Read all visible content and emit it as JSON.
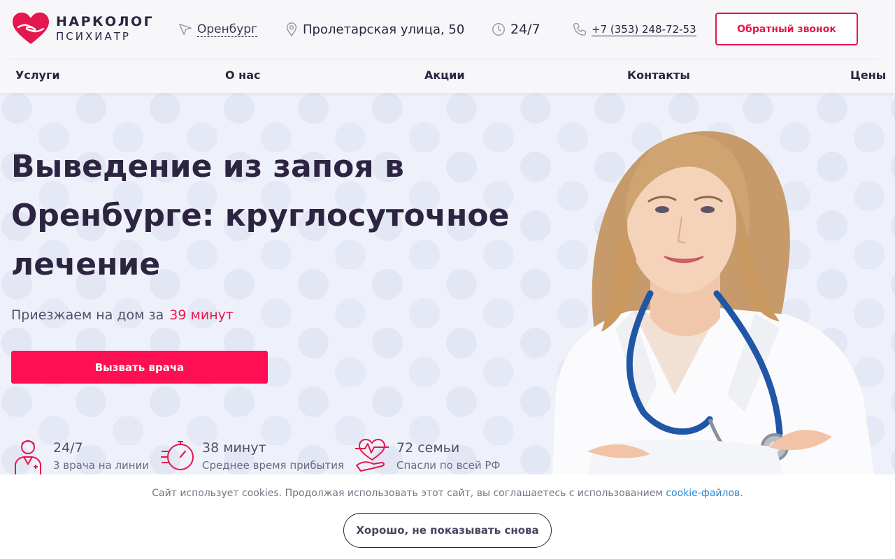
{
  "brand": {
    "line1": "НАРКОЛОГ",
    "line2": "ПСИХИАТР"
  },
  "header": {
    "city": "Оренбург",
    "address": "Пролетарская улица, 50",
    "hours": "24/7",
    "phone": "+7 (353) 248-72-53",
    "callback_label": "Обратный звонок"
  },
  "nav": {
    "items": [
      "Услуги",
      "О нас",
      "Акции",
      "Контакты",
      "Цены"
    ]
  },
  "hero": {
    "title": "Выведение из запоя в Оренбурге: круглосуточное лечение",
    "subtitle": "Приезжаем на дом за",
    "subtitle_accent": "39 минут",
    "cta_label": "Вызвать врача"
  },
  "stats": [
    {
      "value": "24/7",
      "label": "3 врача на линии",
      "icon": "doctor-icon"
    },
    {
      "value": "38 минут",
      "label": "Среднее время прибытия",
      "icon": "stopwatch-icon"
    },
    {
      "value": "72 семьи",
      "label": "Спасли по всей РФ",
      "icon": "heart-hand-icon"
    }
  ],
  "cookie": {
    "text": "Сайт использует cookies. Продолжая использовать этот сайт, вы соглашаетесь с использованием ",
    "link_text": "cookie-файлов",
    "tail": ".",
    "button_label": "Хорошо, не показывать снова"
  },
  "colors": {
    "accent": "#fe0e52",
    "brand_red": "#e4174f",
    "text_dark": "#2c2440",
    "link_blue": "#2a87d0",
    "hero_bg": "#eef1fa"
  }
}
